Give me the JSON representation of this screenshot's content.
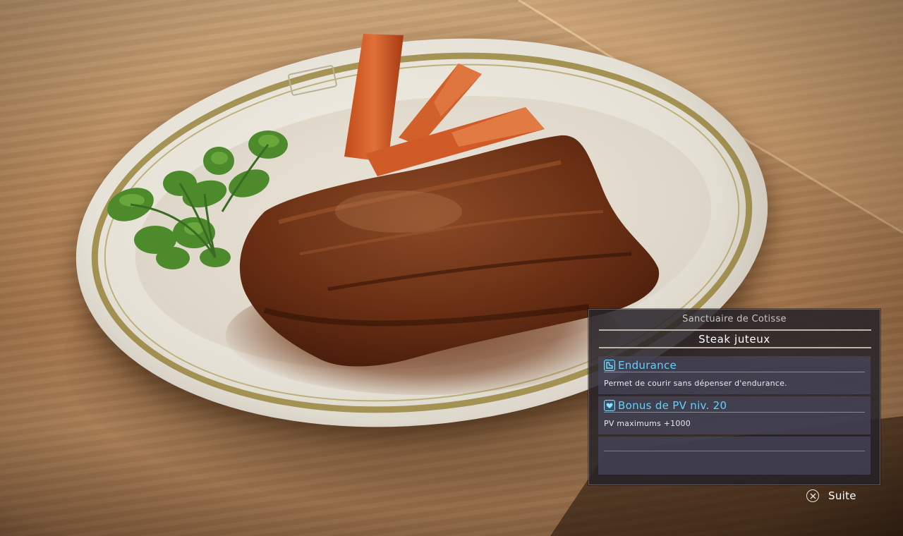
{
  "panel": {
    "location": "Sanctuaire de Cotisse",
    "dish_name": "Steak juteux",
    "effects": [
      {
        "icon": "running-shoe-icon",
        "name": "Endurance",
        "description": "Permet de courir sans dépenser d'endurance."
      },
      {
        "icon": "heart-shield-icon",
        "name": "Bonus de PV niv. 20",
        "description": "PV maximums +1000"
      }
    ],
    "accent_color": "#5fd2ff"
  },
  "prompt": {
    "button_icon": "cross-button-icon",
    "label": "Suite"
  }
}
